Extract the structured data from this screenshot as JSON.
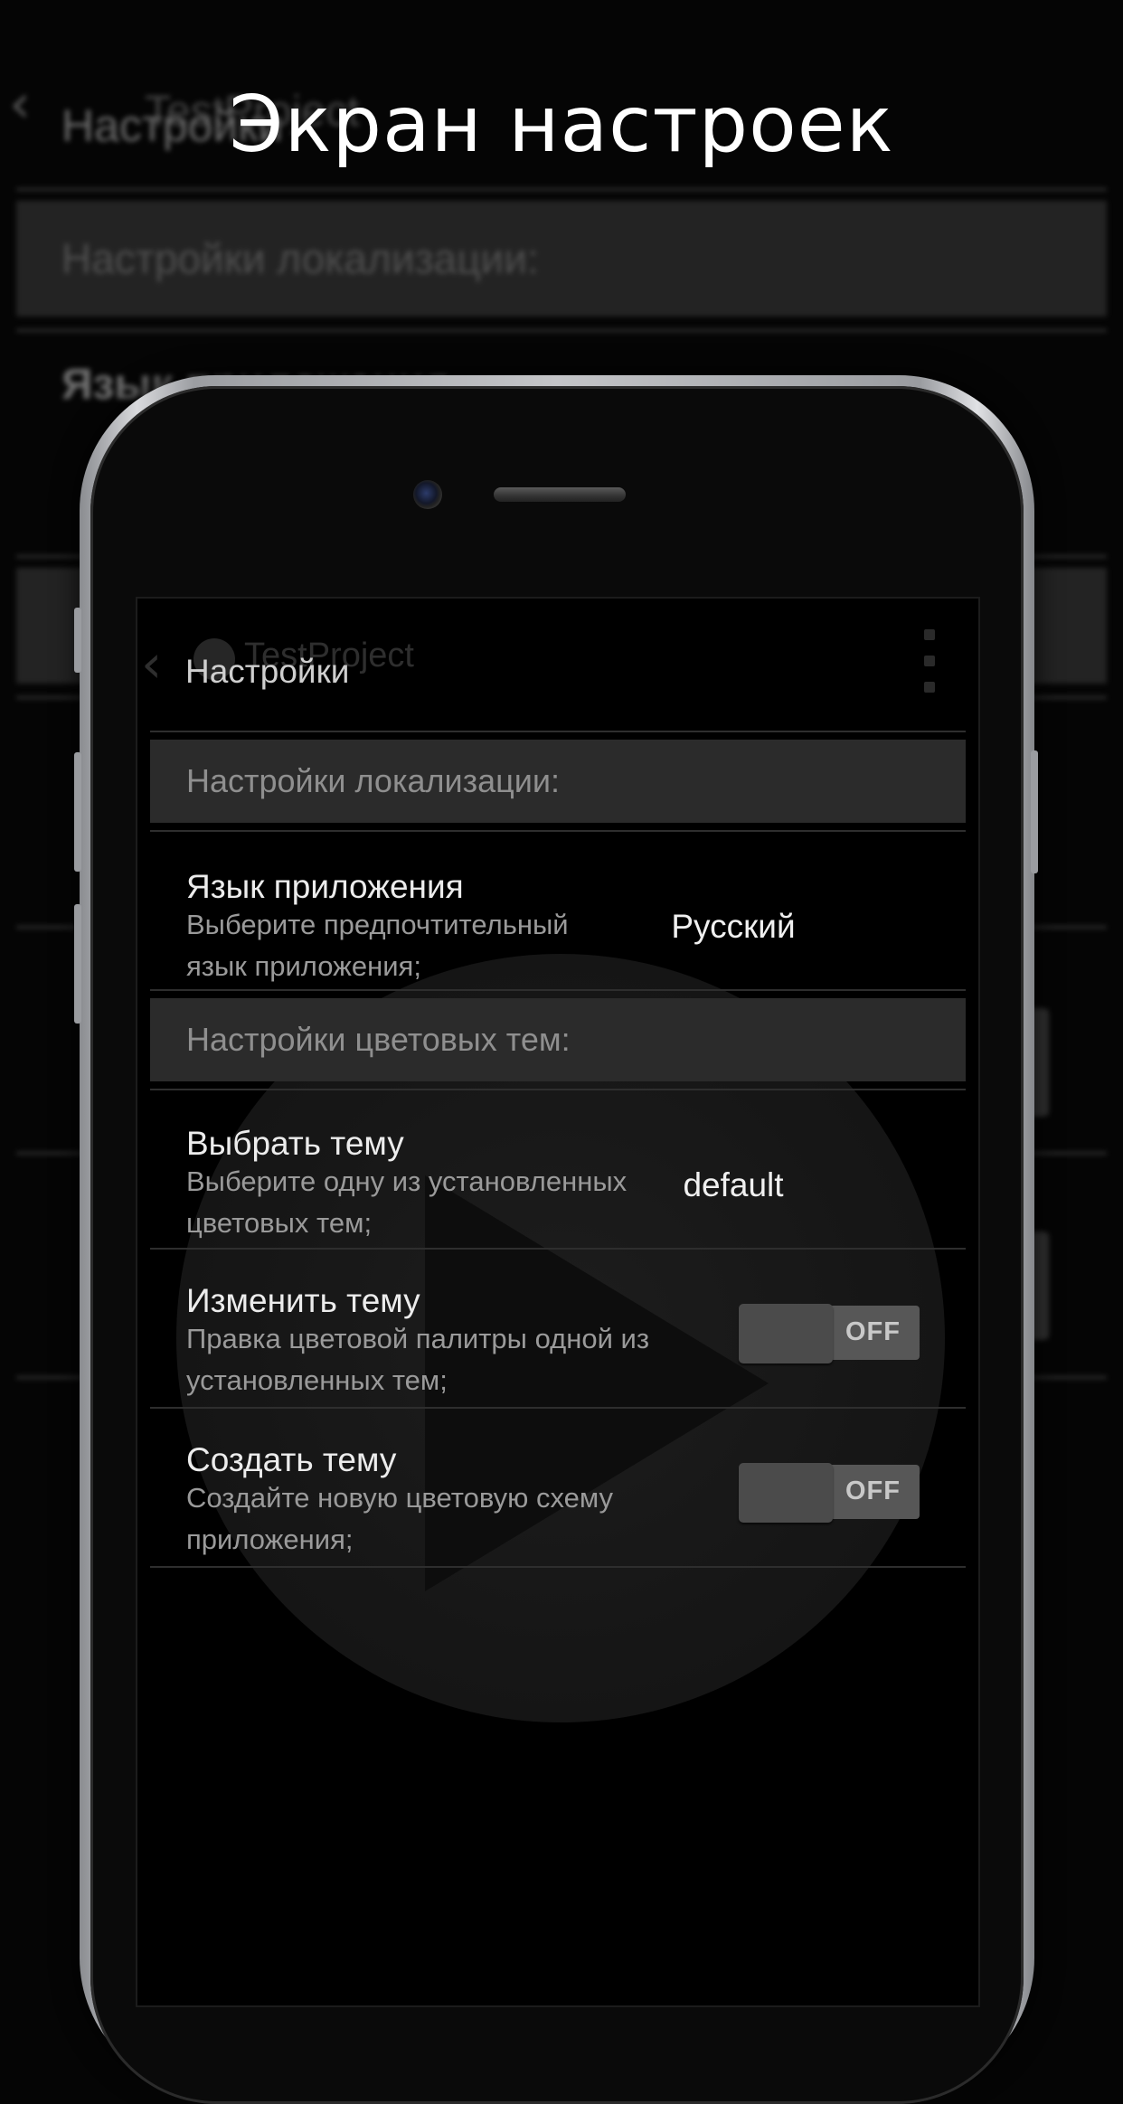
{
  "heading": "Экран настроек",
  "background_screen": {
    "title_ghost": "TestProject",
    "title": "Настройки",
    "section_localization": "Настройки локализации:",
    "item_language_title": "Язык приложения"
  },
  "app": {
    "ghost_title": "TestProject",
    "title": "Настройки",
    "sections": {
      "localization": "Настройки локализации:",
      "themes": "Настройки цветовых тем:"
    },
    "language": {
      "title": "Язык приложения",
      "subtitle": "Выберите предпочтительный язык приложения;",
      "value": "Русский"
    },
    "choose_theme": {
      "title": "Выбрать тему",
      "subtitle": "Выберите одну из установленных цветовых тем;",
      "value": "default"
    },
    "edit_theme": {
      "title": "Изменить тему",
      "subtitle": "Правка цветовой палитры одной из установленных тем;",
      "toggle": "OFF"
    },
    "create_theme": {
      "title": "Создать тему",
      "subtitle": "Создайте новую цветовую схему приложения;",
      "toggle": "OFF"
    }
  },
  "colors": {
    "background": "#050505",
    "section_bg": "#2b2b2b",
    "toggle_track": "#575757",
    "heading": "#ffffff"
  }
}
